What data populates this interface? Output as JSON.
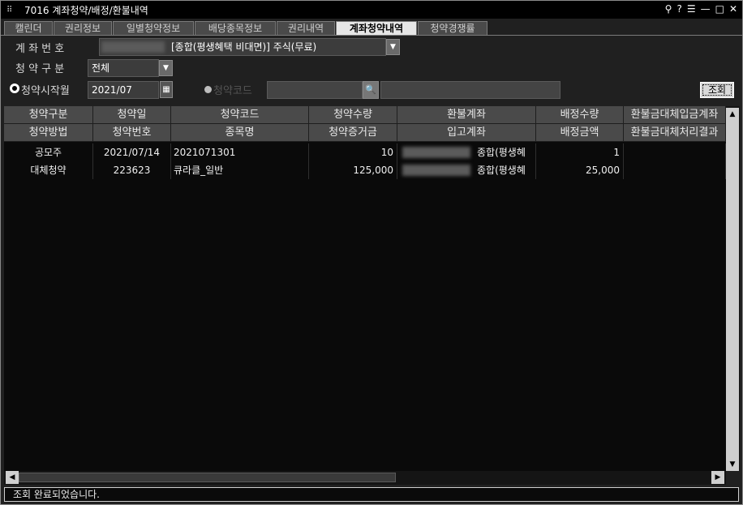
{
  "window": {
    "title": "7016 계좌청약/배정/환불내역",
    "controls": [
      "⚲",
      "?",
      "☰",
      "—",
      "□",
      "✕"
    ]
  },
  "tabs": [
    {
      "label": "캘린더",
      "active": false
    },
    {
      "label": "권리정보",
      "active": false
    },
    {
      "label": "일별청약정보",
      "active": false
    },
    {
      "label": "배당종목정보",
      "active": false
    },
    {
      "label": "권리내역",
      "active": false
    },
    {
      "label": "계좌청약내역",
      "active": true
    },
    {
      "label": "청약경쟁률",
      "active": false
    }
  ],
  "form": {
    "account_label": "계 좌 번 호",
    "account_name": "[종합(평생혜택 비대면)] 주식(무료)",
    "type_label": "청 약 구 분",
    "type_value": "전체",
    "start_month_label": "청약시작월",
    "start_month_value": "2021/07",
    "code_label": "청약코드",
    "search_button": "조회"
  },
  "table": {
    "header_row1": [
      "청약구분",
      "청약일",
      "청약코드",
      "청약수량",
      "환불계좌",
      "배정수량",
      "환불금대체입금계좌"
    ],
    "header_row2": [
      "청약방법",
      "청약번호",
      "종목명",
      "청약증거금",
      "입고계좌",
      "배정금액",
      "환불금대체처리결과"
    ],
    "rows": [
      {
        "line1": [
          "공모주",
          "2021/07/14",
          "2021071301",
          "10",
          "종합(평생혜",
          "1",
          ""
        ],
        "line2": [
          "대체청약",
          "223623",
          "큐라클_일반",
          "125,000",
          "종합(평생혜",
          "25,000",
          ""
        ]
      }
    ]
  },
  "status": {
    "message": "조회 완료되었습니다."
  },
  "colors": {
    "title_bar": "#000000",
    "header_cell": "#4a4a4a",
    "grid_bg": "#0a0a0a",
    "active_tab": "#e6e6e6"
  }
}
